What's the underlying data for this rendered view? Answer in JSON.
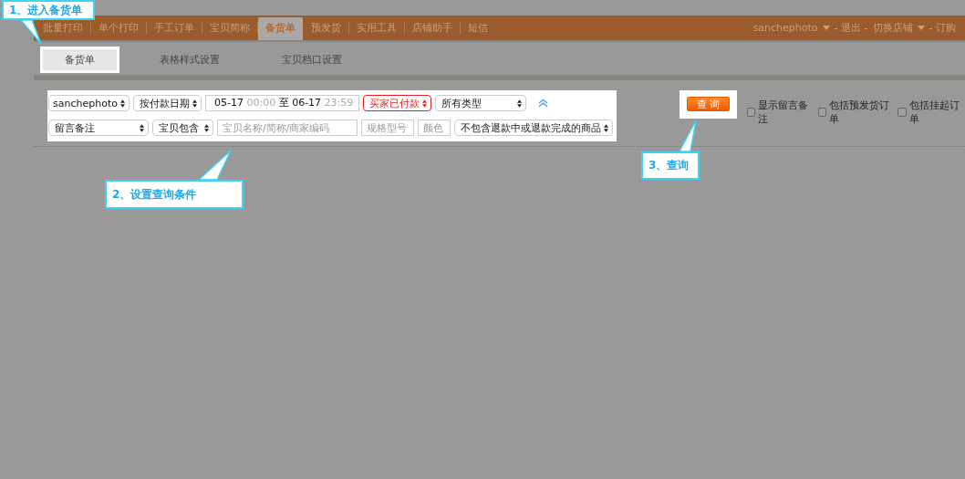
{
  "nav": {
    "items": [
      {
        "label": "批量打印",
        "selected": false
      },
      {
        "label": "单个打印",
        "selected": false
      },
      {
        "label": "手工订单",
        "selected": false
      },
      {
        "label": "宝贝简称",
        "selected": false
      },
      {
        "label": "备货单",
        "selected": true
      },
      {
        "label": "预发货",
        "selected": false
      },
      {
        "label": "实用工具",
        "selected": false
      },
      {
        "label": "店铺助手",
        "selected": false
      },
      {
        "label": "短信",
        "selected": false
      }
    ],
    "user_menu": [
      {
        "label": "sanchephoto",
        "dropdown": true
      },
      {
        "label": "- 退出 -",
        "dropdown": false
      },
      {
        "label": "切换店铺",
        "dropdown": true
      },
      {
        "label": "- 订购",
        "dropdown": false
      }
    ]
  },
  "subtabs": [
    {
      "label": "备货单",
      "selected": true
    },
    {
      "label": "表格样式设置",
      "selected": false
    },
    {
      "label": "宝贝档口设置",
      "selected": false
    }
  ],
  "filters": {
    "rows": [
      [
        {
          "kind": "select",
          "value": "sanchephoto"
        },
        {
          "kind": "select",
          "value": "按付款日期"
        },
        {
          "kind": "daterange",
          "start_date": "05-17",
          "start_time": "00:00",
          "separator": "至",
          "end_date": "06-17",
          "end_time": "23:59"
        },
        {
          "kind": "select",
          "value": "买家已付款",
          "color": "#e8201c"
        },
        {
          "kind": "select",
          "value": "所有类型"
        },
        {
          "kind": "collapse"
        }
      ],
      [
        {
          "kind": "select",
          "value": "留言备注"
        },
        {
          "kind": "select",
          "value": "宝贝包含"
        },
        {
          "kind": "input",
          "placeholder": "宝贝名称/简称/商家编码"
        },
        {
          "kind": "input",
          "placeholder": "规格型号"
        },
        {
          "kind": "input",
          "placeholder": "颜色"
        },
        {
          "kind": "select",
          "value": "不包含退款中或退款完成的商品"
        }
      ]
    ]
  },
  "query_button": "查 询",
  "options": [
    {
      "label": "显示留言备注",
      "checked": false
    },
    {
      "label": "包括预发货订单",
      "checked": false
    },
    {
      "label": "包括挂起订单",
      "checked": false
    }
  ],
  "callouts": [
    {
      "text": "1、进入备货单"
    },
    {
      "text": "2、设置查询条件"
    },
    {
      "text": "3、查询"
    }
  ]
}
